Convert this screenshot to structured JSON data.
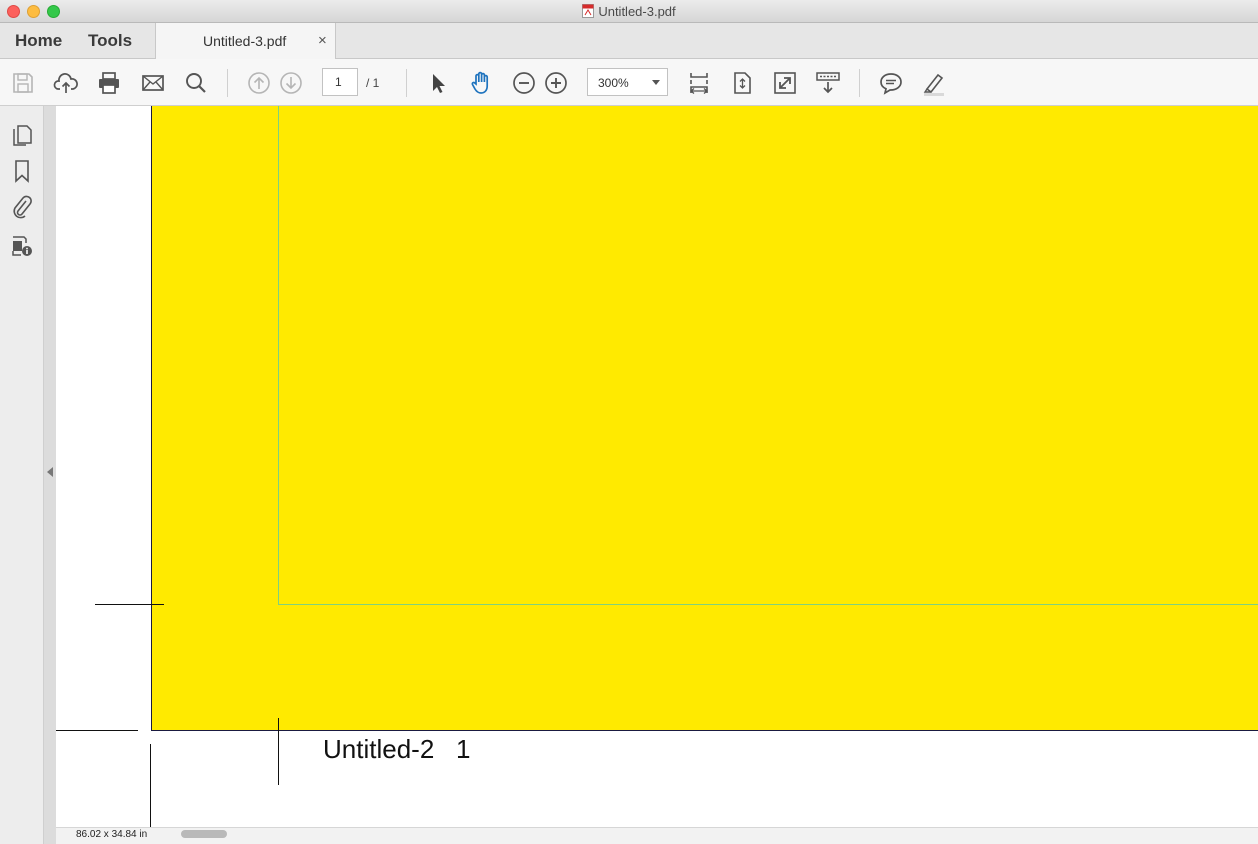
{
  "window": {
    "title": "Untitled-3.pdf"
  },
  "tabs": {
    "home": "Home",
    "tools": "Tools",
    "document": {
      "label": "Untitled-3.pdf",
      "close": "×"
    }
  },
  "toolbar": {
    "page_current": "1",
    "page_total": "/ 1",
    "zoom": "300%"
  },
  "document": {
    "slug_label": "Untitled-2   1",
    "fill_color": "#ffea00"
  },
  "status": {
    "dimensions": "86.02 x 34.84 in"
  },
  "colors": {
    "accent": "#1e73be",
    "trim_guide": "#7fd07f"
  }
}
